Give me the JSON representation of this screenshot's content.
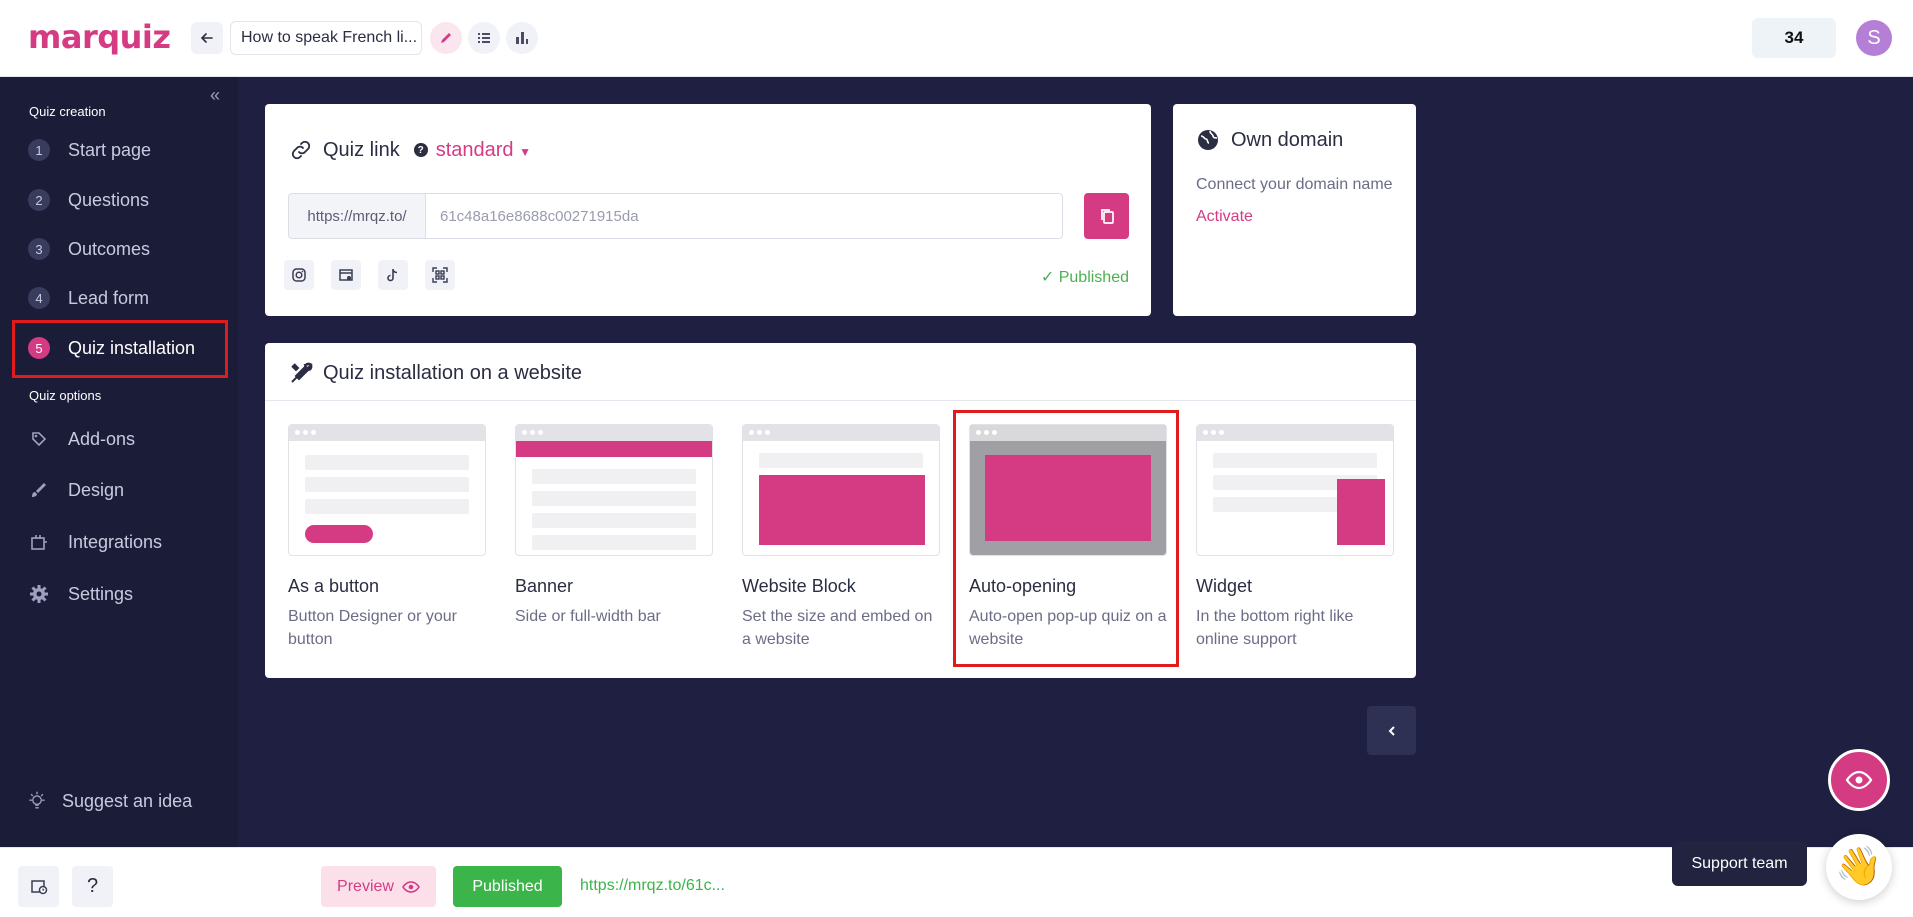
{
  "header": {
    "logo": "marquiz",
    "quiz_title": "How to speak French li...",
    "counter": "34",
    "avatar_letter": "S"
  },
  "sidebar": {
    "section_creation": "Quiz creation",
    "creation_items": [
      {
        "num": "1",
        "label": "Start page"
      },
      {
        "num": "2",
        "label": "Questions"
      },
      {
        "num": "3",
        "label": "Outcomes"
      },
      {
        "num": "4",
        "label": "Lead form"
      },
      {
        "num": "5",
        "label": "Quiz installation"
      }
    ],
    "section_options": "Quiz options",
    "option_items": [
      {
        "icon": "puzzle-icon",
        "label": "Add-ons"
      },
      {
        "icon": "brush-icon",
        "label": "Design"
      },
      {
        "icon": "plug-icon",
        "label": "Integrations"
      },
      {
        "icon": "gear-icon",
        "label": "Settings"
      }
    ],
    "suggest": "Suggest an idea"
  },
  "quiz_link": {
    "title": "Quiz link",
    "mode": "standard",
    "prefix": "https://mrqz.to/",
    "value": "61c48a16e8688c00271915da",
    "status": "Published"
  },
  "own_domain": {
    "title": "Own domain",
    "text": "Connect your domain name",
    "link": "Activate"
  },
  "install": {
    "title": "Quiz installation on a website",
    "options": [
      {
        "title": "As a button",
        "desc": "Button Designer or your button"
      },
      {
        "title": "Banner",
        "desc": "Side or full-width bar"
      },
      {
        "title": "Website Block",
        "desc": "Set the size and embed on a website"
      },
      {
        "title": "Auto-opening",
        "desc": "Auto-open pop-up quiz on a website"
      },
      {
        "title": "Widget",
        "desc": "In the bottom right like online support"
      }
    ]
  },
  "bottom": {
    "help": "?",
    "preview": "Preview",
    "published": "Published",
    "link": "https://mrqz.to/61c..."
  },
  "support": {
    "label": "Support team"
  },
  "colors": {
    "accent": "#d43b83",
    "sidebar_bg": "#1b1c37",
    "content_bg": "#1f2041",
    "success": "#3bb54a",
    "highlight": "#e01b1b"
  }
}
